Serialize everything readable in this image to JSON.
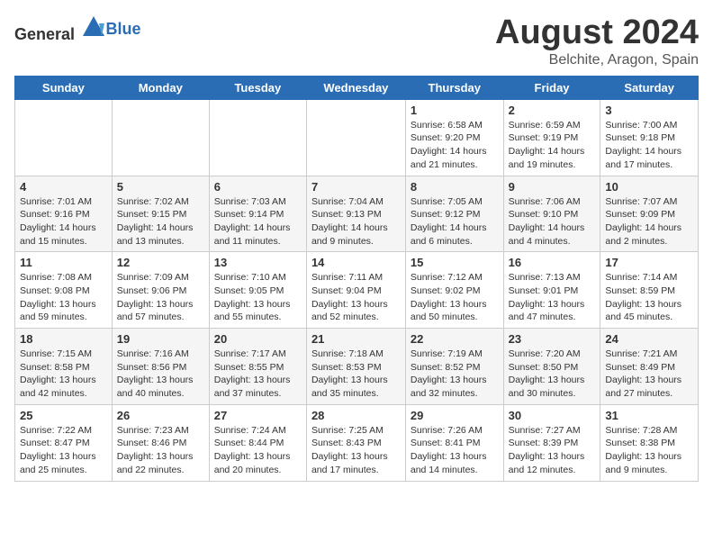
{
  "header": {
    "logo_general": "General",
    "logo_blue": "Blue",
    "title": "August 2024",
    "subtitle": "Belchite, Aragon, Spain"
  },
  "days_of_week": [
    "Sunday",
    "Monday",
    "Tuesday",
    "Wednesday",
    "Thursday",
    "Friday",
    "Saturday"
  ],
  "weeks": [
    {
      "days": [
        {
          "num": "",
          "info": ""
        },
        {
          "num": "",
          "info": ""
        },
        {
          "num": "",
          "info": ""
        },
        {
          "num": "",
          "info": ""
        },
        {
          "num": "1",
          "info": "Sunrise: 6:58 AM\nSunset: 9:20 PM\nDaylight: 14 hours\nand 21 minutes."
        },
        {
          "num": "2",
          "info": "Sunrise: 6:59 AM\nSunset: 9:19 PM\nDaylight: 14 hours\nand 19 minutes."
        },
        {
          "num": "3",
          "info": "Sunrise: 7:00 AM\nSunset: 9:18 PM\nDaylight: 14 hours\nand 17 minutes."
        }
      ]
    },
    {
      "days": [
        {
          "num": "4",
          "info": "Sunrise: 7:01 AM\nSunset: 9:16 PM\nDaylight: 14 hours\nand 15 minutes."
        },
        {
          "num": "5",
          "info": "Sunrise: 7:02 AM\nSunset: 9:15 PM\nDaylight: 14 hours\nand 13 minutes."
        },
        {
          "num": "6",
          "info": "Sunrise: 7:03 AM\nSunset: 9:14 PM\nDaylight: 14 hours\nand 11 minutes."
        },
        {
          "num": "7",
          "info": "Sunrise: 7:04 AM\nSunset: 9:13 PM\nDaylight: 14 hours\nand 9 minutes."
        },
        {
          "num": "8",
          "info": "Sunrise: 7:05 AM\nSunset: 9:12 PM\nDaylight: 14 hours\nand 6 minutes."
        },
        {
          "num": "9",
          "info": "Sunrise: 7:06 AM\nSunset: 9:10 PM\nDaylight: 14 hours\nand 4 minutes."
        },
        {
          "num": "10",
          "info": "Sunrise: 7:07 AM\nSunset: 9:09 PM\nDaylight: 14 hours\nand 2 minutes."
        }
      ]
    },
    {
      "days": [
        {
          "num": "11",
          "info": "Sunrise: 7:08 AM\nSunset: 9:08 PM\nDaylight: 13 hours\nand 59 minutes."
        },
        {
          "num": "12",
          "info": "Sunrise: 7:09 AM\nSunset: 9:06 PM\nDaylight: 13 hours\nand 57 minutes."
        },
        {
          "num": "13",
          "info": "Sunrise: 7:10 AM\nSunset: 9:05 PM\nDaylight: 13 hours\nand 55 minutes."
        },
        {
          "num": "14",
          "info": "Sunrise: 7:11 AM\nSunset: 9:04 PM\nDaylight: 13 hours\nand 52 minutes."
        },
        {
          "num": "15",
          "info": "Sunrise: 7:12 AM\nSunset: 9:02 PM\nDaylight: 13 hours\nand 50 minutes."
        },
        {
          "num": "16",
          "info": "Sunrise: 7:13 AM\nSunset: 9:01 PM\nDaylight: 13 hours\nand 47 minutes."
        },
        {
          "num": "17",
          "info": "Sunrise: 7:14 AM\nSunset: 8:59 PM\nDaylight: 13 hours\nand 45 minutes."
        }
      ]
    },
    {
      "days": [
        {
          "num": "18",
          "info": "Sunrise: 7:15 AM\nSunset: 8:58 PM\nDaylight: 13 hours\nand 42 minutes."
        },
        {
          "num": "19",
          "info": "Sunrise: 7:16 AM\nSunset: 8:56 PM\nDaylight: 13 hours\nand 40 minutes."
        },
        {
          "num": "20",
          "info": "Sunrise: 7:17 AM\nSunset: 8:55 PM\nDaylight: 13 hours\nand 37 minutes."
        },
        {
          "num": "21",
          "info": "Sunrise: 7:18 AM\nSunset: 8:53 PM\nDaylight: 13 hours\nand 35 minutes."
        },
        {
          "num": "22",
          "info": "Sunrise: 7:19 AM\nSunset: 8:52 PM\nDaylight: 13 hours\nand 32 minutes."
        },
        {
          "num": "23",
          "info": "Sunrise: 7:20 AM\nSunset: 8:50 PM\nDaylight: 13 hours\nand 30 minutes."
        },
        {
          "num": "24",
          "info": "Sunrise: 7:21 AM\nSunset: 8:49 PM\nDaylight: 13 hours\nand 27 minutes."
        }
      ]
    },
    {
      "days": [
        {
          "num": "25",
          "info": "Sunrise: 7:22 AM\nSunset: 8:47 PM\nDaylight: 13 hours\nand 25 minutes."
        },
        {
          "num": "26",
          "info": "Sunrise: 7:23 AM\nSunset: 8:46 PM\nDaylight: 13 hours\nand 22 minutes."
        },
        {
          "num": "27",
          "info": "Sunrise: 7:24 AM\nSunset: 8:44 PM\nDaylight: 13 hours\nand 20 minutes."
        },
        {
          "num": "28",
          "info": "Sunrise: 7:25 AM\nSunset: 8:43 PM\nDaylight: 13 hours\nand 17 minutes."
        },
        {
          "num": "29",
          "info": "Sunrise: 7:26 AM\nSunset: 8:41 PM\nDaylight: 13 hours\nand 14 minutes."
        },
        {
          "num": "30",
          "info": "Sunrise: 7:27 AM\nSunset: 8:39 PM\nDaylight: 13 hours\nand 12 minutes."
        },
        {
          "num": "31",
          "info": "Sunrise: 7:28 AM\nSunset: 8:38 PM\nDaylight: 13 hours\nand 9 minutes."
        }
      ]
    }
  ]
}
